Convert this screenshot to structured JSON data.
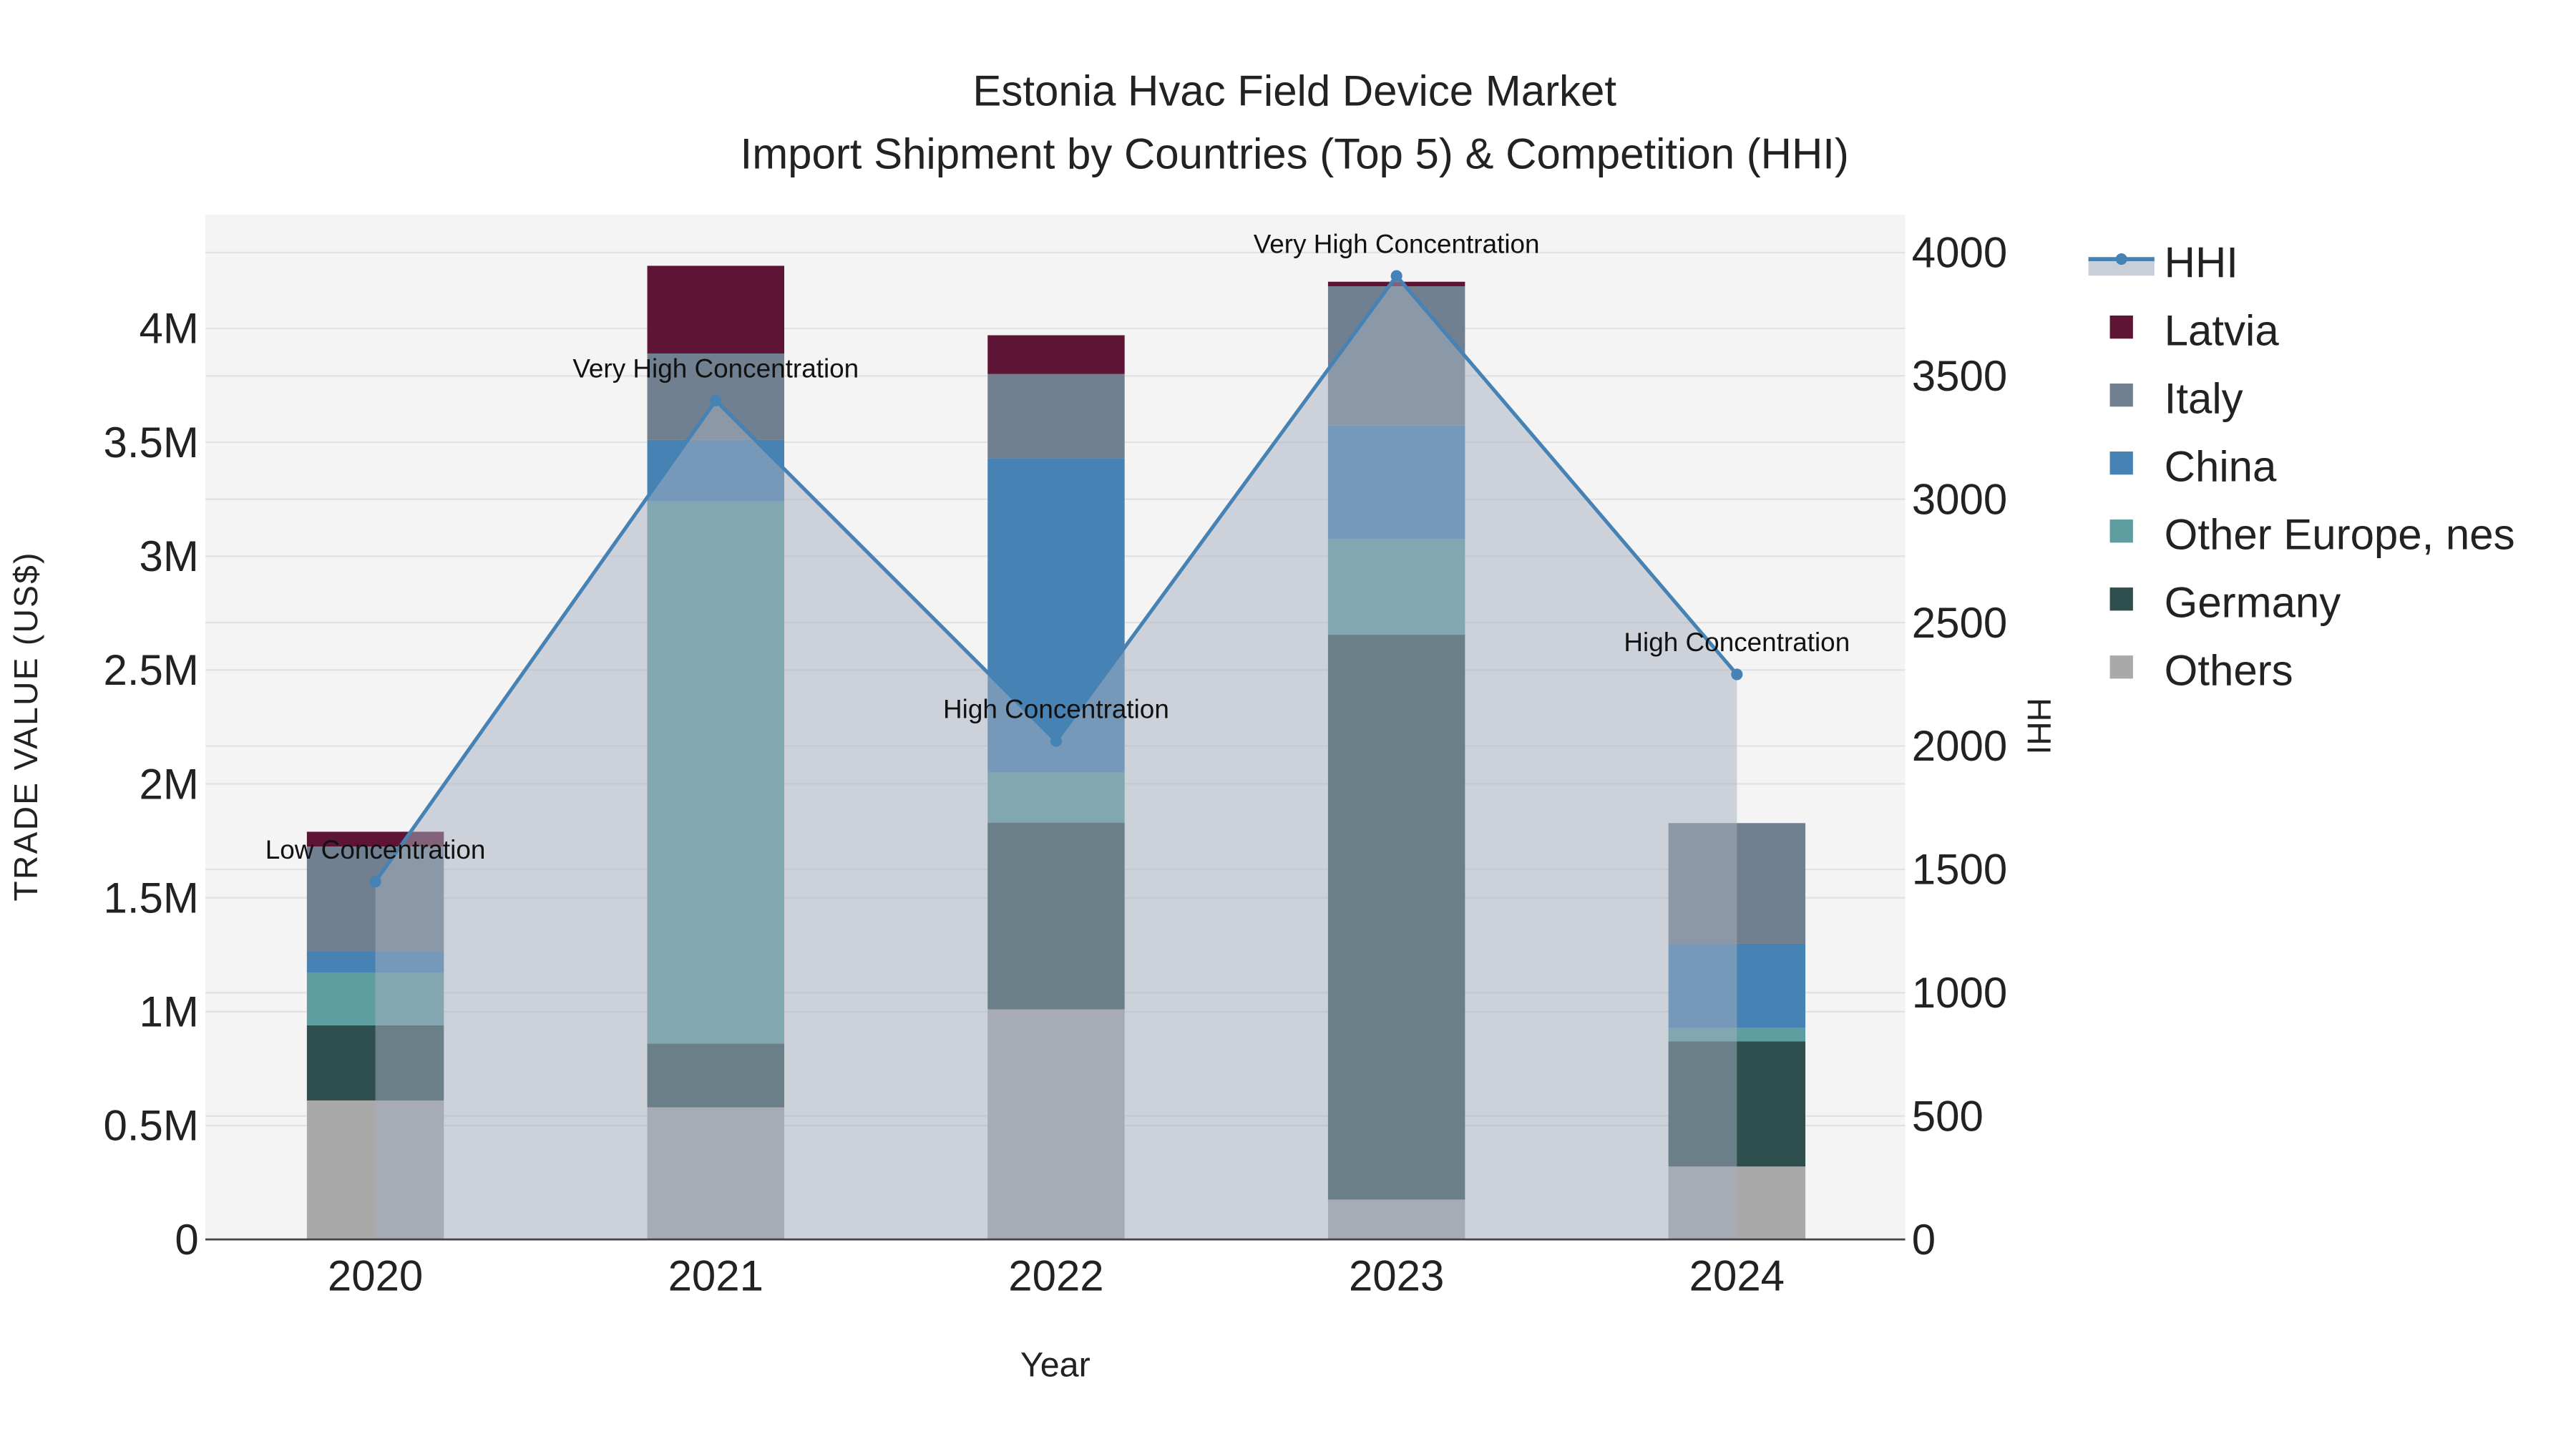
{
  "chart_data": {
    "type": "bar",
    "title": "Estonia Hvac Field Device Market",
    "subtitle": "Import Shipment by Countries (Top 5) & Competition (HHI)",
    "xlabel": "Year",
    "ylabel": "TRADE VALUE (US$)",
    "y2label": "HHI",
    "categories": [
      "2020",
      "2021",
      "2022",
      "2023",
      "2024"
    ],
    "ylim": [
      0,
      4500000
    ],
    "y2lim": [
      0,
      4150
    ],
    "yticks": [
      0,
      500000,
      1000000,
      1500000,
      2000000,
      2500000,
      3000000,
      3500000,
      4000000
    ],
    "yticklabels": [
      "0",
      "0.5M",
      "1M",
      "1.5M",
      "2M",
      "2.5M",
      "3M",
      "3.5M",
      "4M"
    ],
    "y2ticks": [
      0,
      500,
      1000,
      1500,
      2000,
      2500,
      3000,
      3500,
      4000
    ],
    "y2ticklabels": [
      "0",
      "500",
      "1000",
      "1500",
      "2000",
      "2500",
      "3000",
      "3500",
      "4000"
    ],
    "stacked": true,
    "grid": true,
    "legend_position": "right",
    "series": [
      {
        "name": "Others",
        "color": "#a9a9a9",
        "values": [
          610000,
          580000,
          1010000,
          175000,
          320000
        ]
      },
      {
        "name": "Germany",
        "color": "#2f4f4f",
        "values": [
          330000,
          280000,
          820000,
          2480000,
          550000
        ]
      },
      {
        "name": "Other Europe, nes",
        "color": "#5f9ea0",
        "values": [
          230000,
          2380000,
          220000,
          420000,
          58000
        ]
      },
      {
        "name": "China",
        "color": "#4682b4",
        "values": [
          95000,
          270000,
          1380000,
          500000,
          370000
        ]
      },
      {
        "name": "Italy",
        "color": "#708090",
        "values": [
          460000,
          380000,
          370000,
          610000,
          530000
        ]
      },
      {
        "name": "Latvia",
        "color": "#5e1435",
        "values": [
          65000,
          385000,
          170000,
          20000,
          0
        ]
      }
    ],
    "hhi": {
      "name": "HHI",
      "color": "#4682b4",
      "values": [
        1450,
        3400,
        2020,
        3905,
        2290
      ],
      "annotations": [
        "Low Concentration",
        "Very High Concentration",
        "High Concentration",
        "Very High Concentration",
        "High Concentration"
      ]
    },
    "legend_order": [
      "HHI",
      "Latvia",
      "Italy",
      "China",
      "Other Europe, nes",
      "Germany",
      "Others"
    ]
  }
}
